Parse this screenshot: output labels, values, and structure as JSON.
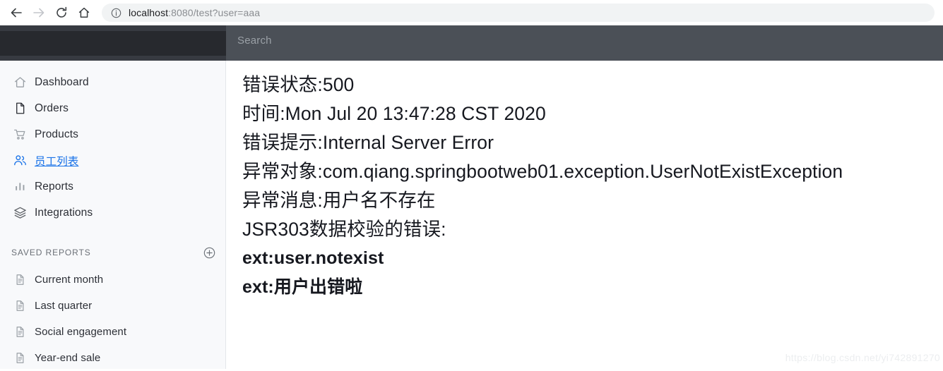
{
  "browser": {
    "back_icon": "back-arrow-icon",
    "forward_icon": "forward-arrow-icon",
    "reload_icon": "reload-icon",
    "home_icon": "home-icon",
    "site_info_icon": "site-info-icon",
    "url_host": "localhost",
    "url_path": ":8080/test?user=aaa",
    "url_full": "localhost:8080/test?user=aaa"
  },
  "header": {
    "search_placeholder": "Search"
  },
  "sidebar": {
    "items": [
      {
        "label": "Dashboard",
        "icon": "home-icon",
        "active": false
      },
      {
        "label": "Orders",
        "icon": "document-icon",
        "active": false
      },
      {
        "label": "Products",
        "icon": "shopping-cart-icon",
        "active": false
      },
      {
        "label": "员工列表",
        "icon": "people-icon",
        "active": true
      },
      {
        "label": "Reports",
        "icon": "bar-chart-icon",
        "active": false
      },
      {
        "label": "Integrations",
        "icon": "layers-icon",
        "active": false
      }
    ],
    "saved_reports": {
      "title": "SAVED REPORTS",
      "add_icon": "plus-circle-icon",
      "items": [
        {
          "label": "Current month",
          "icon": "report-file-icon"
        },
        {
          "label": "Last quarter",
          "icon": "report-file-icon"
        },
        {
          "label": "Social engagement",
          "icon": "report-file-icon"
        },
        {
          "label": "Year-end sale",
          "icon": "report-file-icon"
        }
      ]
    }
  },
  "main": {
    "lines": [
      {
        "text": "错误状态:500",
        "bold": false
      },
      {
        "text": "时间:Mon Jul 20 13:47:28 CST 2020",
        "bold": false
      },
      {
        "text": "错误提示:Internal Server Error",
        "bold": false
      },
      {
        "text": "异常对象:com.qiang.springbootweb01.exception.UserNotExistException",
        "bold": false
      },
      {
        "text": "异常消息:用户名不存在",
        "bold": false
      },
      {
        "text": "JSR303数据校验的错误:",
        "bold": false
      },
      {
        "text": "ext:user.notexist",
        "bold": true
      },
      {
        "text": "ext:用户出错啦",
        "bold": true
      }
    ],
    "watermark": "https://blog.csdn.net/yi742891270"
  },
  "colors": {
    "accent_link": "#1a73e8",
    "sidebar_bg": "#f8f9fb",
    "header_bar": "#4b5057",
    "brand_block": "#27292e",
    "text_primary": "#16181f"
  }
}
